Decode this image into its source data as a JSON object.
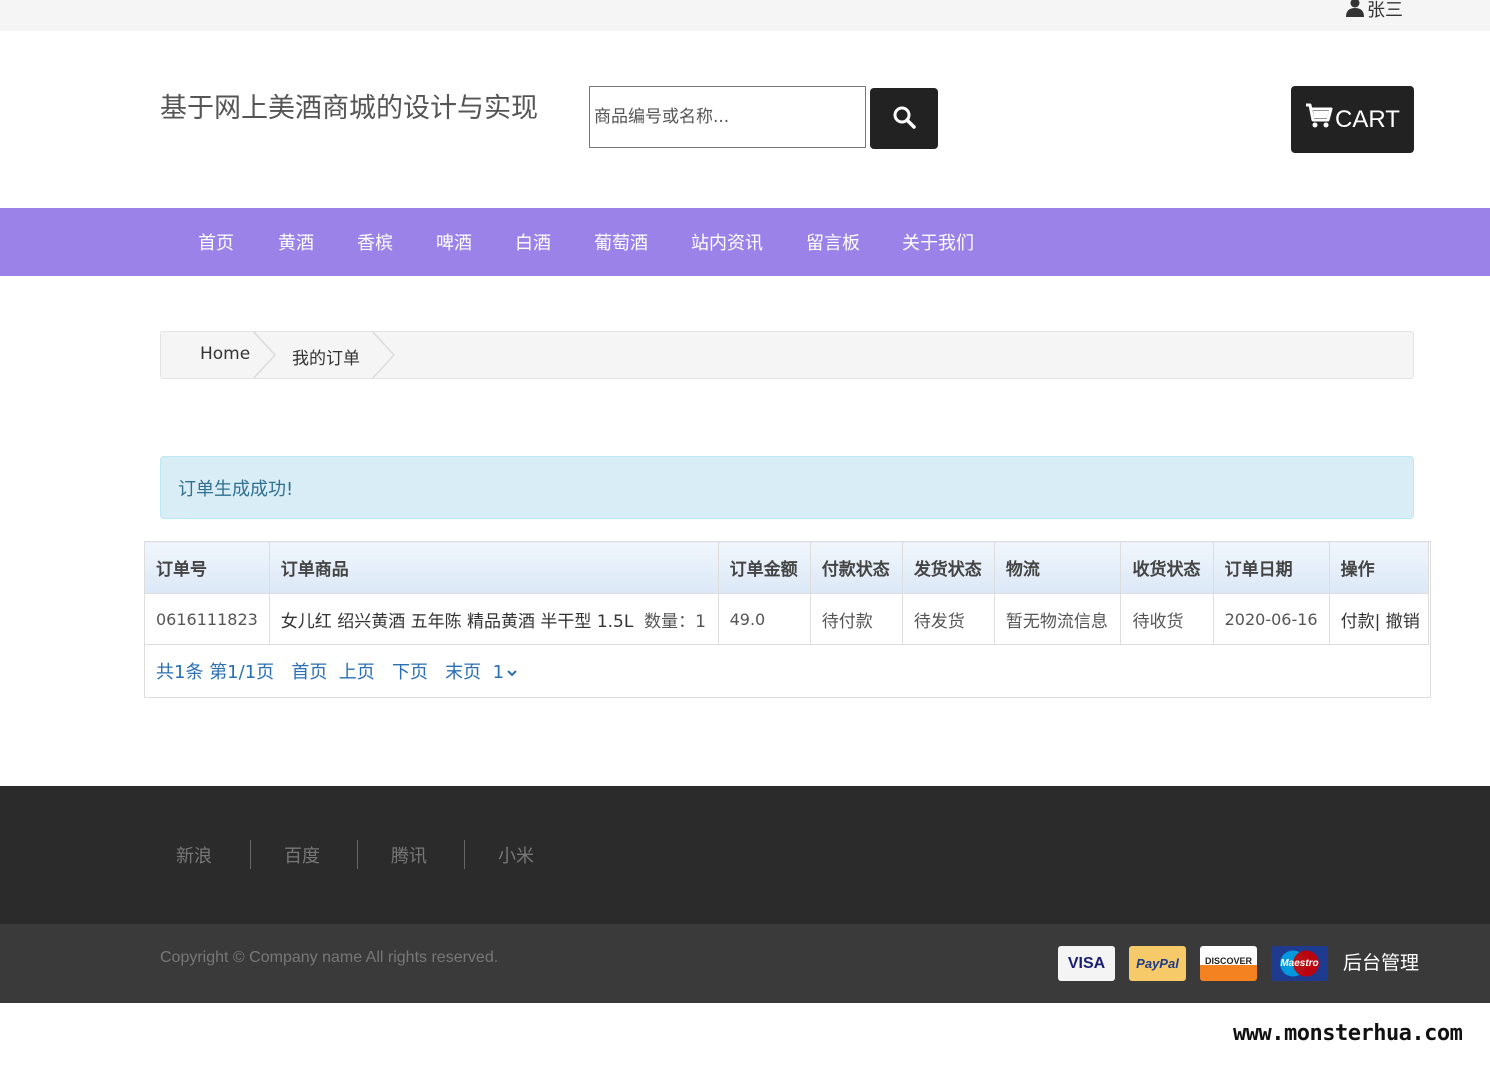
{
  "topbar": {
    "user_name": "张三"
  },
  "header": {
    "site_title": "基于网上美酒商城的设计与实现",
    "search_placeholder": "商品编号或名称...",
    "cart_label": "CART"
  },
  "nav": {
    "items": [
      "首页",
      "黄酒",
      "香槟",
      "啤酒",
      "白酒",
      "葡萄酒",
      "站内资讯",
      "留言板",
      "关于我们"
    ]
  },
  "breadcrumb": {
    "home": "Home",
    "current": "我的订单"
  },
  "alert": {
    "message": "订单生成成功!"
  },
  "orders": {
    "columns": [
      "订单号",
      "订单商品",
      "订单金额",
      "付款状态",
      "发货状态",
      "物流",
      "收货状态",
      "订单日期",
      "操作"
    ],
    "rows": [
      {
        "order_no": "0616111823",
        "product": "女儿红 绍兴黄酒 五年陈 精品黄酒 半干型 1.5L",
        "quantity": "数量：1",
        "amount": "49.0",
        "pay_status": "待付款",
        "ship_status": "待发货",
        "logistics": "暂无物流信息",
        "receive_status": "待收货",
        "date": "2020-06-16",
        "action_pay": "付款",
        "action_sep": "|",
        "action_cancel": "撤销"
      }
    ]
  },
  "pagination": {
    "total": "共1条",
    "page_info": "第1/1页",
    "first": "首页",
    "prev": "上页",
    "next": "下页",
    "last": "末页",
    "page_select": "1"
  },
  "footer": {
    "links": [
      "新浪",
      "百度",
      "腾讯",
      "小米"
    ],
    "copyright": "Copyright © Company name All rights reserved.",
    "payment_icons": [
      {
        "name": "visa-icon",
        "label": "VISA"
      },
      {
        "name": "paypal-icon",
        "label": "PayPal"
      },
      {
        "name": "discover-icon",
        "label": "DISCOVER"
      },
      {
        "name": "maestro-icon",
        "label": "Maestro"
      }
    ],
    "admin_link": "后台管理"
  },
  "watermark": "www.monsterhua.com",
  "colors": {
    "nav_bg": "#9b82e8",
    "footer_top": "#2b2b2b",
    "footer_bottom": "#3a3a3a",
    "alert_bg": "#d9edf7",
    "link": "#2a6fb5"
  }
}
